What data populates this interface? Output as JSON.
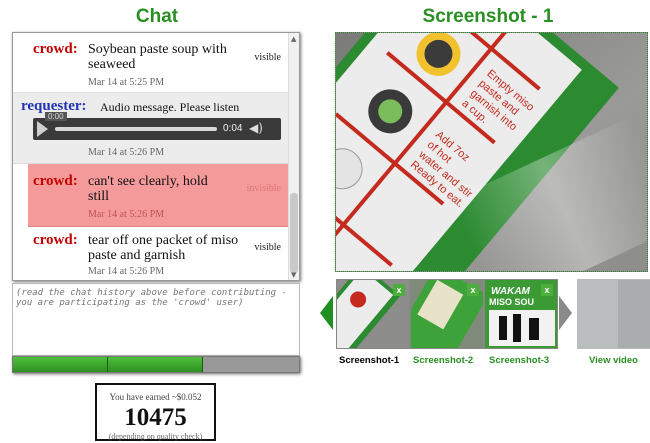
{
  "chat": {
    "heading": "Chat",
    "messages": [
      {
        "sender": "crowd",
        "text": "Soybean paste soup with seaweed",
        "visibility": "visible",
        "time": "Mar 14 at 5:25 PM"
      },
      {
        "sender": "requester",
        "text": "Audio message. Please listen",
        "time": "Mar 14 at 5:26 PM",
        "audio": {
          "elapsed": "0:00",
          "duration": "0:04"
        }
      },
      {
        "sender": "crowd",
        "text": "can't see clearly, hold still",
        "visibility": "invisible",
        "time": "Mar 14 at 5:26 PM"
      },
      {
        "sender": "crowd",
        "text": "tear off one packet of miso paste and garnish",
        "visibility": "visible",
        "time": "Mar 14 at 5:26 PM"
      }
    ],
    "input_placeholder": "(read the chat history above before contributing - you are participating as the 'crowd' user)",
    "progress_segments": 3,
    "progress_filled": 2
  },
  "earnings": {
    "earned_line": "You have earned ~$0.052",
    "points": "10475",
    "note": "(depending on quality check)"
  },
  "screenshots": {
    "heading": "Screenshot - 1",
    "thumbnails": [
      {
        "label": "Screenshot-1",
        "label_color": "#111111",
        "close": "x"
      },
      {
        "label": "Screenshot-2",
        "label_color": "#2a8f22",
        "close": "x"
      },
      {
        "label": "Screenshot-3",
        "label_color": "#2a8f22",
        "close": "x"
      },
      {
        "label": "View video",
        "label_color": "#2a8f22"
      }
    ],
    "package_text": {
      "main_lines": [
        "Empty miso",
        "paste and",
        "garnish into",
        "a cup.",
        "Add 7oz",
        "of hot",
        "water and stir",
        "Ready to eat."
      ],
      "thumb3_brand": "WAKAM",
      "thumb3_brand2": "MISO SOU"
    }
  },
  "colors": {
    "heading_green": "#2a8f22",
    "crowd_red": "#c40000",
    "requester_blue": "#2233b5",
    "invisible_highlight": "#f59a9a"
  },
  "icons": {
    "play": "play-icon",
    "volume": "volume-icon",
    "prev": "chevron-left-icon",
    "next": "chevron-right-icon",
    "close": "close-icon"
  }
}
